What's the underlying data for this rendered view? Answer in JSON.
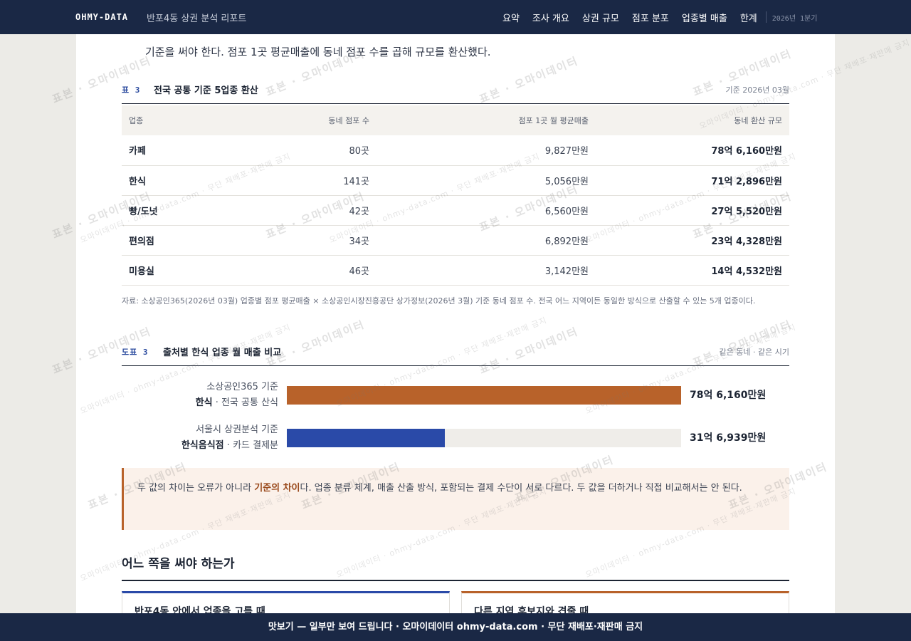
{
  "header": {
    "brand": "OHMY-DATA",
    "report_title": "반포4동 상권 분석 리포트",
    "nav": [
      "요약",
      "조사 개요",
      "상권 규모",
      "점포 분포",
      "업종별 매출",
      "한계"
    ],
    "date": "2026년 1분기"
  },
  "intro": {
    "line2": "기준을 써야 한다. 점포 1곳 평균매출에 동네 점포 수를 곱해 규모를 환산했다."
  },
  "table3": {
    "label": "표 3",
    "title": "전국 공통 기준 5업종 환산",
    "meta": "기준 2026년 03월",
    "headers": [
      "업종",
      "동네 점포 수",
      "점포 1곳 월 평균매출",
      "동네 환산 규모"
    ],
    "rows": [
      {
        "name": "카페",
        "count": "80곳",
        "avg": "9,827만원",
        "total": "78억 6,160만원"
      },
      {
        "name": "한식",
        "count": "141곳",
        "avg": "5,056만원",
        "total": "71억 2,896만원"
      },
      {
        "name": "빵/도넛",
        "count": "42곳",
        "avg": "6,560만원",
        "total": "27억 5,520만원"
      },
      {
        "name": "편의점",
        "count": "34곳",
        "avg": "6,892만원",
        "total": "23억 4,328만원"
      },
      {
        "name": "미용실",
        "count": "46곳",
        "avg": "3,142만원",
        "total": "14억 4,532만원"
      }
    ],
    "source": "자료: 소상공인365(2026년 03월) 업종별 점포 평균매출 × 소상공인시장진흥공단 상가정보(2026년 3월) 기준 동네 점포 수. 전국 어느 지역이든 동일한 방식으로 산출할 수 있는 5개 업종이다."
  },
  "figure3": {
    "label": "도표 3",
    "title": "출처별 한식 업종 월 매출 비교",
    "meta": "같은 동네 · 같은 시기"
  },
  "chart_data": {
    "type": "bar",
    "orientation": "horizontal",
    "categories": [
      "소상공인365 기준 한식 · 전국 공통 산식",
      "서울시 상권분석 기준 한식음식점 · 카드 결제분"
    ],
    "values": [
      7116.0,
      3169.39
    ],
    "unit": "만원",
    "series": [
      {
        "source": "소상공인365 기준",
        "category": "한식",
        "note": "전국 공통 산식",
        "value_label": "78억 6,160만원",
        "color": "#b8622a"
      },
      {
        "source": "서울시 상권분석 기준",
        "category": "한식음식점",
        "note": "카드 결제분",
        "value_label": "31억 6,939만원",
        "color": "#2a4aa8"
      }
    ],
    "bar_fills": [
      1.0,
      0.4
    ],
    "title": "출처별 한식 업종 월 매출 비교"
  },
  "callout": {
    "before": "두 값의 차이는 오류가 아니라 ",
    "emphasis": "기준의 차이",
    "after": "다. 업종 분류 체계, 매출 산출 방식, 포함되는 결제 수단이 서로 다르다. 두 값을 더하거나 직접 비교해서는 안 된다."
  },
  "section": {
    "heading": "어느 쪽을 써야 하는가",
    "card_left": "반포4동 안에서 업종을 고를 때",
    "card_right": "다른 지역 후보지와 견줄 때"
  },
  "watermark": {
    "big": "표본 · 오마이데이터",
    "small": "오마이데이터 · ohmy-data.com · 무단 재배포·재판매 금지"
  },
  "banner": {
    "text": "맛보기 — 일부만 보여 드립니다 · 오마이데이터 ohmy-data.com · 무단 재배포·재판매 금지"
  }
}
